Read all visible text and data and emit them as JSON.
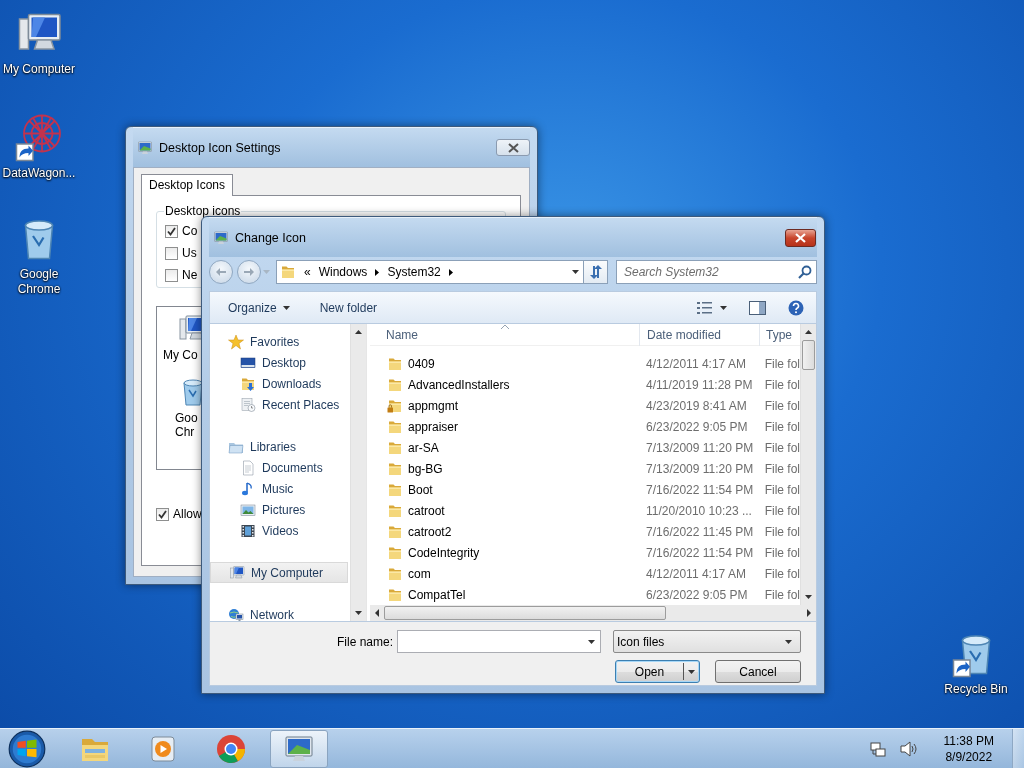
{
  "desktop_icons": [
    {
      "label": "My Computer",
      "kind": "computer"
    },
    {
      "label": "DataWagon...",
      "kind": "mesh"
    },
    {
      "label": "Google Chrome",
      "kind": "bin"
    },
    {
      "label": "Recycle Bin",
      "kind": "binshort"
    }
  ],
  "settings_window": {
    "title": "Desktop Icon Settings",
    "tabs": [
      {
        "label": "Desktop Icons",
        "selected": true
      }
    ],
    "group_title": "Desktop icons",
    "checkboxes": [
      {
        "label": "Co",
        "checked": true
      },
      {
        "label": "Us",
        "checked": false
      },
      {
        "label": "Ne",
        "checked": false
      }
    ],
    "preview_icons": [
      {
        "kind": "computer",
        "lines": [
          "My Co"
        ]
      },
      {
        "kind": "bin",
        "lines": [
          "Goo",
          "Chr"
        ]
      }
    ],
    "allow_checkbox": {
      "label": "Allow",
      "checked": true
    }
  },
  "dialog": {
    "title": "Change Icon",
    "address": {
      "overflow": "«",
      "crumbs": [
        "Windows",
        "System32"
      ]
    },
    "search": {
      "placeholder": "Search System32"
    },
    "toolbar": {
      "organize": "Organize",
      "new_folder": "New folder"
    },
    "nav": [
      {
        "label": "Favorites",
        "kind": "star",
        "selected": false,
        "children": [
          {
            "label": "Desktop",
            "kind": "desktop",
            "selected": false
          },
          {
            "label": "Downloads",
            "kind": "downloads",
            "selected": false
          },
          {
            "label": "Recent Places",
            "kind": "recent",
            "selected": false
          }
        ]
      },
      {
        "label": "Libraries",
        "kind": "library",
        "selected": false,
        "children": [
          {
            "label": "Documents",
            "kind": "documents",
            "selected": false
          },
          {
            "label": "Music",
            "kind": "music",
            "selected": false
          },
          {
            "label": "Pictures",
            "kind": "pictures",
            "selected": false
          },
          {
            "label": "Videos",
            "kind": "videos",
            "selected": false
          }
        ]
      },
      {
        "label": "My Computer",
        "kind": "computer",
        "selected": true
      },
      {
        "label": "Network",
        "kind": "network",
        "selected": false
      }
    ],
    "columns": [
      {
        "label": "Name",
        "sorted": true
      },
      {
        "label": "Date modified",
        "sorted": false
      },
      {
        "label": "Type",
        "sorted": false
      }
    ],
    "files": [
      {
        "name": "0409",
        "date": "4/12/2011 4:17 AM",
        "type": "File fol",
        "locked": false
      },
      {
        "name": "AdvancedInstallers",
        "date": "4/11/2019 11:28 PM",
        "type": "File fol",
        "locked": false
      },
      {
        "name": "appmgmt",
        "date": "4/23/2019 8:41 AM",
        "type": "File fol",
        "locked": true
      },
      {
        "name": "appraiser",
        "date": "6/23/2022 9:05 PM",
        "type": "File fol",
        "locked": false
      },
      {
        "name": "ar-SA",
        "date": "7/13/2009 11:20 PM",
        "type": "File fol",
        "locked": false
      },
      {
        "name": "bg-BG",
        "date": "7/13/2009 11:20 PM",
        "type": "File fol",
        "locked": false
      },
      {
        "name": "Boot",
        "date": "7/16/2022 11:54 PM",
        "type": "File fol",
        "locked": false
      },
      {
        "name": "catroot",
        "date": "11/20/2010 10:23 ...",
        "type": "File fol",
        "locked": false
      },
      {
        "name": "catroot2",
        "date": "7/16/2022 11:45 PM",
        "type": "File fol",
        "locked": false
      },
      {
        "name": "CodeIntegrity",
        "date": "7/16/2022 11:54 PM",
        "type": "File fol",
        "locked": false
      },
      {
        "name": "com",
        "date": "4/12/2011 4:17 AM",
        "type": "File fol",
        "locked": false
      },
      {
        "name": "CompatTel",
        "date": "6/23/2022 9:05 PM",
        "type": "File fol",
        "locked": false
      }
    ],
    "file_name_label": "File name:",
    "file_type": "Icon files",
    "buttons": [
      {
        "label": "Open",
        "kind": "split",
        "default": true
      },
      {
        "label": "Cancel",
        "kind": "plain",
        "default": false
      }
    ]
  },
  "taskbar": {
    "items": [
      {
        "kind": "explorer",
        "selected": false
      },
      {
        "kind": "media",
        "selected": false
      },
      {
        "kind": "chrome",
        "selected": false
      },
      {
        "kind": "display",
        "selected": true
      }
    ],
    "clock": {
      "time": "11:38 PM",
      "date": "8/9/2022"
    }
  }
}
